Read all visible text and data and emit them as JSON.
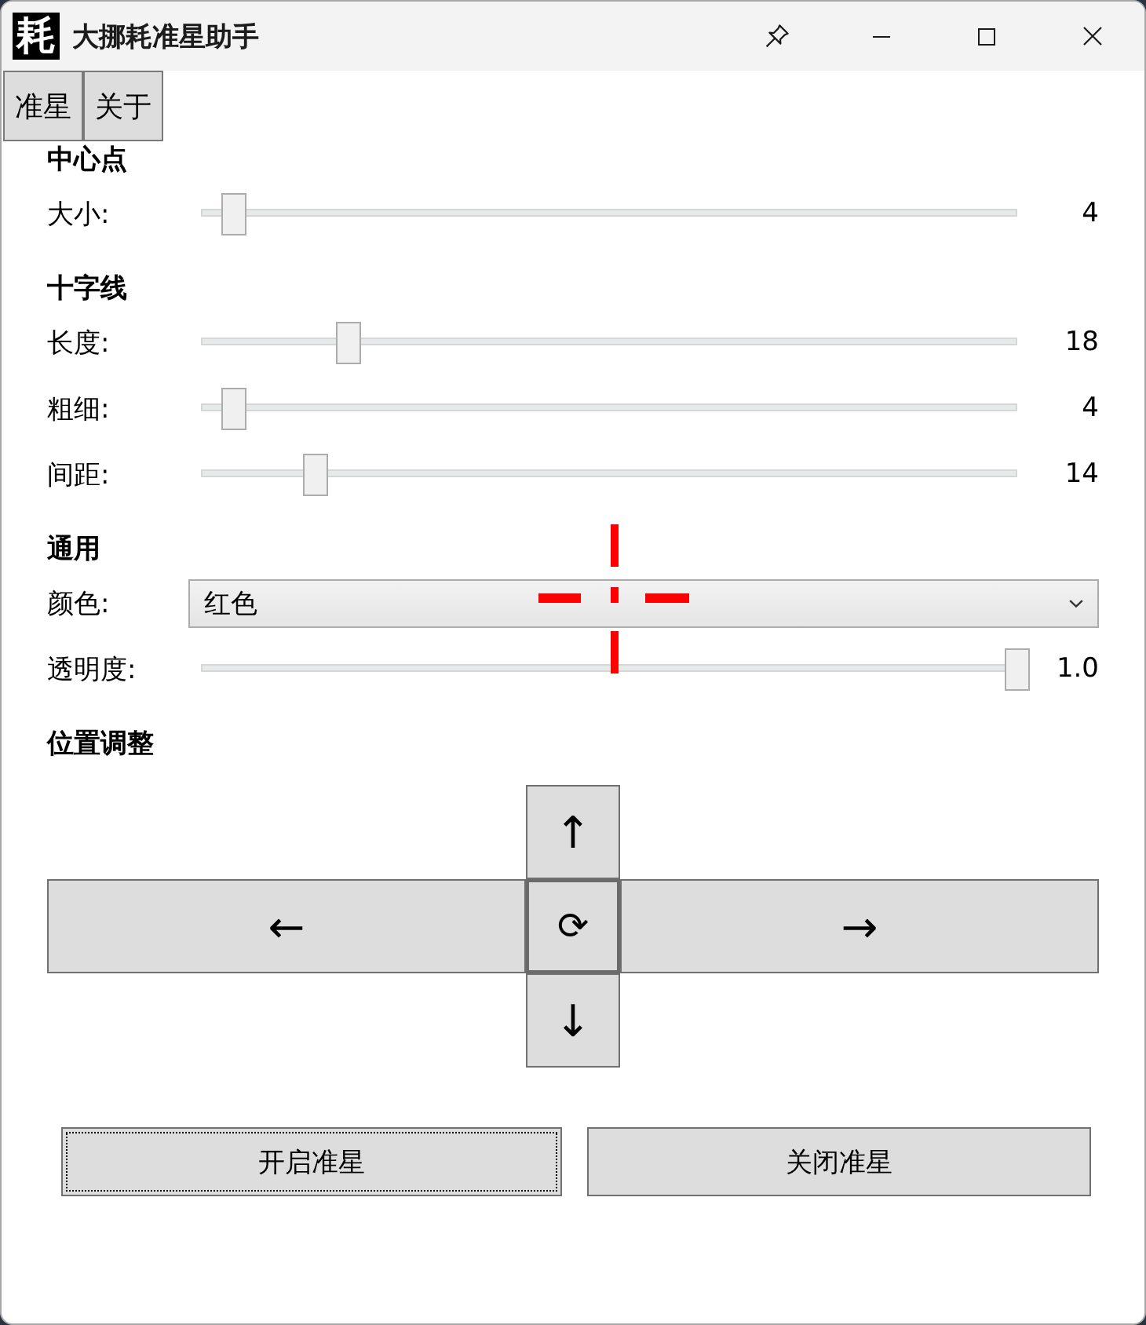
{
  "window": {
    "title": "大挪耗准星助手",
    "icon_text": "耗"
  },
  "tabs": [
    {
      "label": "准星"
    },
    {
      "label": "关于"
    }
  ],
  "sections": [
    {
      "heading": "中心点",
      "rows": [
        {
          "kind": "slider",
          "label": "大小:",
          "level": 0.04,
          "reading": "4"
        }
      ]
    },
    {
      "heading": "十字线",
      "rows": [
        {
          "kind": "slider",
          "label": "长度:",
          "level": 0.18,
          "reading": "18"
        },
        {
          "kind": "slider",
          "label": "粗细:",
          "level": 0.04,
          "reading": "4"
        },
        {
          "kind": "slider",
          "label": "间距:",
          "level": 0.14,
          "reading": "14"
        }
      ]
    },
    {
      "heading": "通用",
      "rows": [
        {
          "kind": "dropdown",
          "label": "颜色:",
          "value": "红色"
        },
        {
          "kind": "slider",
          "label": "透明度:",
          "level": 1,
          "reading": "1.0"
        }
      ]
    },
    {
      "heading": "位置调整",
      "rows": [
        {
          "kind": "dpad",
          "up": "↑",
          "left": "←",
          "center": "⟳",
          "right": "→",
          "down": "↓"
        }
      ]
    }
  ],
  "buttons": [
    {
      "label": "开启准星",
      "focused": true
    },
    {
      "label": "关闭准星",
      "focused": false
    }
  ]
}
